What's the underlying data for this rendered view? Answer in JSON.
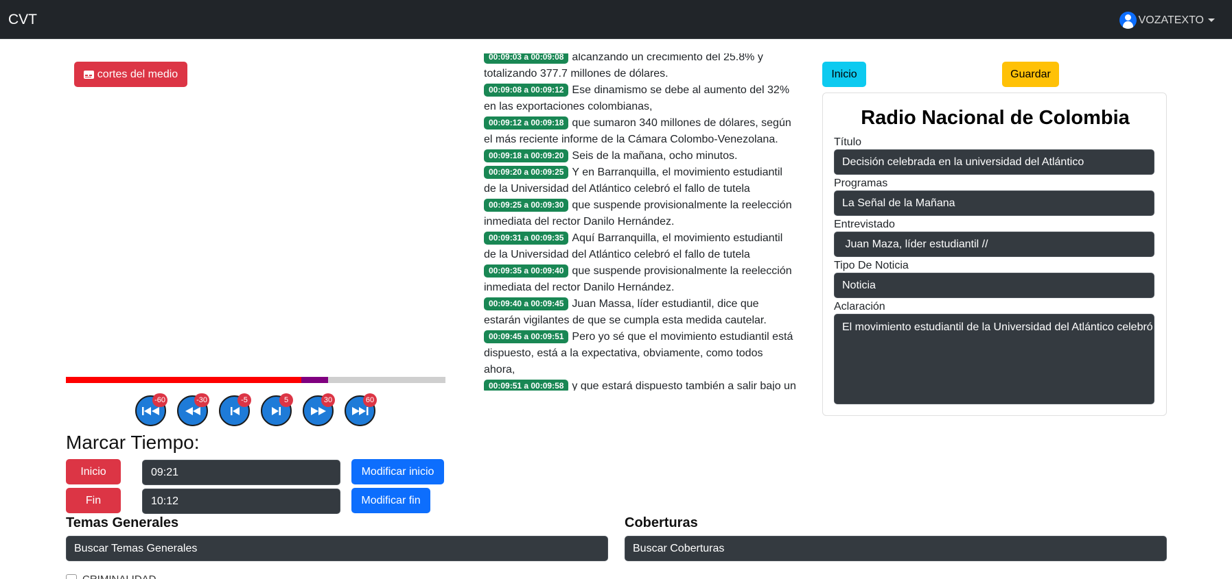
{
  "navbar": {
    "brand": "CVT",
    "user": "VOZATEXTO"
  },
  "player": {
    "cortes_label": "cortes del medio",
    "progress_played": 0.62,
    "segment_start": 0.62,
    "segment_end": 0.69,
    "controls": [
      {
        "name": "rewind-60",
        "icon": "skip-start-icon",
        "badge": "-60"
      },
      {
        "name": "rewind-30",
        "icon": "rewind-icon",
        "badge": "-30"
      },
      {
        "name": "rewind-5",
        "icon": "step-back-icon",
        "badge": "-5"
      },
      {
        "name": "forward-5",
        "icon": "step-forward-icon",
        "badge": "5"
      },
      {
        "name": "forward-30",
        "icon": "fast-forward-icon",
        "badge": "30"
      },
      {
        "name": "forward-60",
        "icon": "skip-end-icon",
        "badge": "60"
      }
    ]
  },
  "marcar": {
    "title": "Marcar Tiempo:",
    "inicio_label": "Inicio",
    "inicio_value": "09:21",
    "modificar_inicio": "Modificar inicio",
    "fin_label": "Fin",
    "fin_value": "10:12",
    "modificar_fin": "Modificar fin"
  },
  "transcript": [
    {
      "ts": "00:09:03 a 00:09:08",
      "text": "alcanzando un crecimiento del 25.8% y totalizando 377.7 millones de dólares."
    },
    {
      "ts": "00:09:08 a 00:09:12",
      "text": "Ese dinamismo se debe al aumento del 32% en las exportaciones colombianas,"
    },
    {
      "ts": "00:09:12 a 00:09:18",
      "text": "que sumaron 340 millones de dólares, según el más reciente informe de la Cámara Colombo-Venezolana."
    },
    {
      "ts": "00:09:18 a 00:09:20",
      "text": "Seis de la mañana, ocho minutos."
    },
    {
      "ts": "00:09:20 a 00:09:25",
      "text": "Y en Barranquilla, el movimiento estudiantil de la Universidad del Atlántico celebró el fallo de tutela"
    },
    {
      "ts": "00:09:25 a 00:09:30",
      "text": "que suspende provisionalmente la reelección inmediata del rector Danilo Hernández."
    },
    {
      "ts": "00:09:31 a 00:09:35",
      "text": "Aquí Barranquilla, el movimiento estudiantil de la Universidad del Atlántico celebró el fallo de tutela"
    },
    {
      "ts": "00:09:35 a 00:09:40",
      "text": "que suspende provisionalmente la reelección inmediata del rector Danilo Hernández."
    },
    {
      "ts": "00:09:40 a 00:09:45",
      "text": "Juan Massa, líder estudiantil, dice que estarán vigilantes de que se cumpla esta medida cautelar."
    },
    {
      "ts": "00:09:45 a 00:09:51",
      "text": "Pero yo sé que el movimiento estudiantil está dispuesto, está a la expectativa, obviamente, como todos ahora,"
    },
    {
      "ts": "00:09:51 a 00:09:58",
      "text": "y que estará dispuesto también a salir bajo un intento forzoso de hacer que el actual rector Danilo Hernández"
    }
  ],
  "form": {
    "inicio_button": "Inicio",
    "guardar_button": "Guardar",
    "medio": "Radio Nacional de Colombia",
    "titulo_label": "Título",
    "titulo_value": "Decisión celebrada en la universidad del Atlántico",
    "programas_label": "Programas",
    "programas_value": "La Señal de la Mañana",
    "entrevistado_label": "Entrevistado",
    "entrevistado_value": " Juan Maza, líder estudiantil //",
    "tipo_label": "Tipo De Noticia",
    "tipo_value": "Noticia",
    "aclaracion_label": "Aclaración",
    "aclaracion_value": "El movimiento estudiantil de la Universidad del Atlántico celebró el fallo de tutela"
  },
  "temas": {
    "title": "Temas Generales",
    "placeholder": "Buscar Temas Generales",
    "first_option": "CRIMINALIDAD"
  },
  "coberturas": {
    "title": "Coberturas",
    "placeholder": "Buscar Coberturas"
  }
}
